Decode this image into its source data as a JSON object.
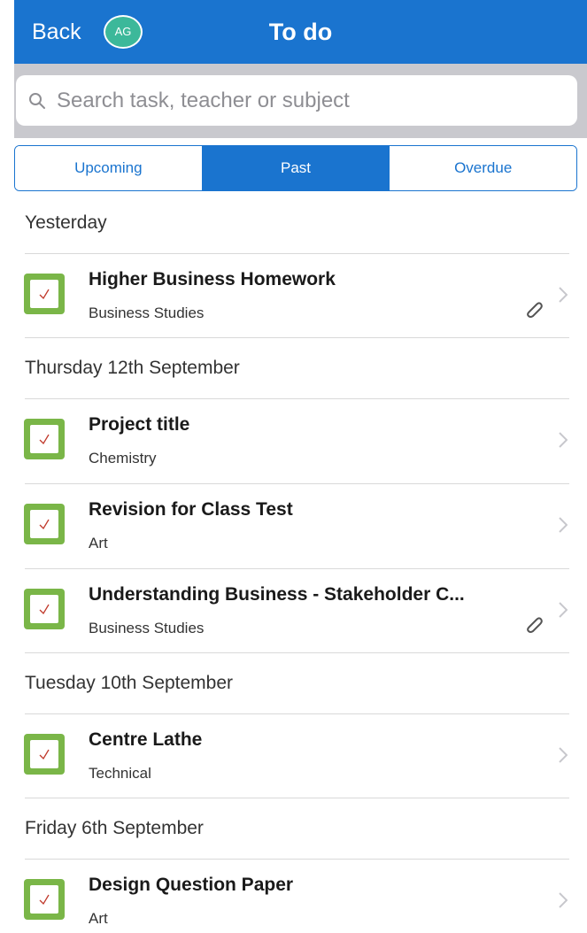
{
  "nav": {
    "back_label": "Back",
    "avatar_initials": "AG",
    "title": "To do"
  },
  "search": {
    "placeholder": "Search task, teacher or subject"
  },
  "tabs": [
    {
      "label": "Upcoming",
      "active": false
    },
    {
      "label": "Past",
      "active": true
    },
    {
      "label": "Overdue",
      "active": false
    }
  ],
  "sections": [
    {
      "header": "Yesterday",
      "tasks": [
        {
          "title": "Higher Business Homework",
          "subject": "Business Studies",
          "attachment": true,
          "completed": true
        }
      ]
    },
    {
      "header": "Thursday 12th September",
      "tasks": [
        {
          "title": "Project title",
          "subject": "Chemistry",
          "attachment": false,
          "completed": true
        },
        {
          "title": "Revision for Class Test",
          "subject": "Art",
          "attachment": false,
          "completed": true
        },
        {
          "title": "Understanding Business - Stakeholder C...",
          "subject": "Business Studies",
          "attachment": true,
          "completed": true
        }
      ]
    },
    {
      "header": "Tuesday 10th September",
      "tasks": [
        {
          "title": "Centre Lathe",
          "subject": "Technical",
          "attachment": false,
          "completed": true
        }
      ]
    },
    {
      "header": "Friday 6th September",
      "tasks": [
        {
          "title": "Design Question Paper",
          "subject": "Art",
          "attachment": false,
          "completed": true
        }
      ]
    }
  ],
  "colors": {
    "nav_blue": "#1a74cf",
    "avatar_green": "#3cb89a",
    "check_green": "#7ab648",
    "search_bar_bg": "#c9c9ce"
  }
}
